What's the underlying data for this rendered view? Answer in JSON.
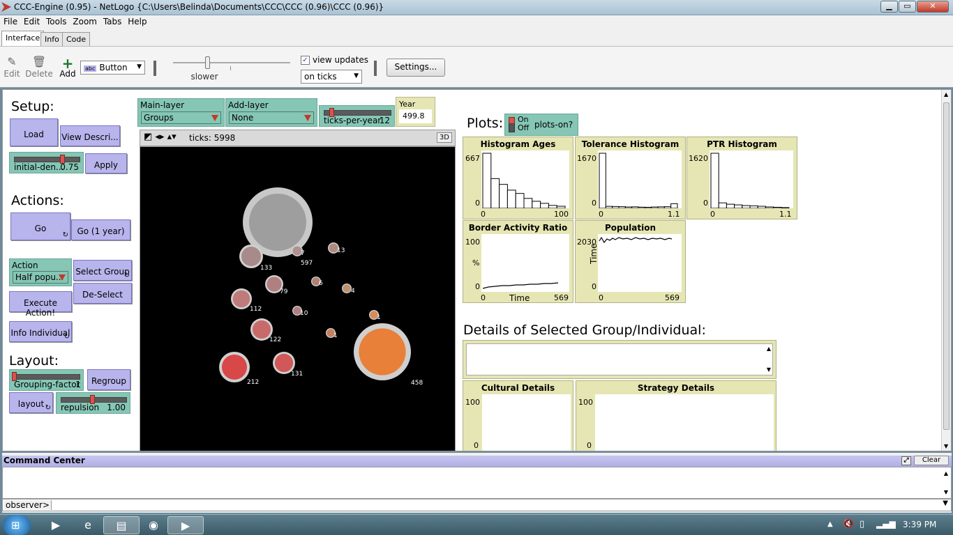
{
  "window": {
    "title": "CCC-Engine (0.95) - NetLogo {C:\\Users\\Belinda\\Documents\\CCC\\CCC (0.96)\\CCC (0.96)}",
    "minimize": "▁",
    "maximize": "▭",
    "close": "✕"
  },
  "menu": [
    "File",
    "Edit",
    "Tools",
    "Zoom",
    "Tabs",
    "Help"
  ],
  "tabs": [
    "Interface",
    "Info",
    "Code"
  ],
  "toolbar": {
    "edit": "Edit",
    "delete": "Delete",
    "add": "Add",
    "widget_type": "Button",
    "widget_type_icon": "abc",
    "speed_label": "slower",
    "view_updates_label": "view updates",
    "update_mode": "on ticks",
    "settings": "Settings..."
  },
  "setup": {
    "header": "Setup:",
    "load": "Load",
    "view_description": "View Descri...",
    "initial_density_label": "initial-den...",
    "initial_density_value": "0.75",
    "initial_density_fraction": 0.75,
    "apply": "Apply"
  },
  "actions": {
    "header": "Actions:",
    "go": "Go",
    "go_1_year": "Go (1 year)",
    "action_chooser_label": "Action",
    "action_chooser_value": "Half popu...",
    "select_group": "Select Group",
    "de_select": "De-Select",
    "execute_action": "Execute Action!",
    "info_individual": "Info Individual"
  },
  "layout": {
    "header": "Layout:",
    "grouping_factor_label": "Grouping-factor",
    "grouping_factor_value": "1",
    "regroup": "Regroup",
    "layout_button": "layout",
    "repulsion_label": "repulsion",
    "repulsion_value": "1.00"
  },
  "top_controls": {
    "main_layer_label": "Main-layer",
    "main_layer_value": "Groups",
    "add_layer_label": "Add-layer",
    "add_layer_value": "None",
    "ticks_per_year_label": "ticks-per-year",
    "ticks_per_year_value": "12",
    "year_label": "Year",
    "year_value": "499.8"
  },
  "view": {
    "ticks": "ticks: 5998",
    "three_d": "3D",
    "groups": [
      {
        "label": "597",
        "color": "#9e9e9e"
      },
      {
        "label": "133",
        "color": "#a88a8a"
      },
      {
        "label": "7",
        "color": "#b09090"
      },
      {
        "label": "13",
        "color": "#b08a80"
      },
      {
        "label": "79",
        "color": "#b08080"
      },
      {
        "label": "6",
        "color": "#b08070"
      },
      {
        "label": "4",
        "color": "#c09070"
      },
      {
        "label": "112",
        "color": "#c07a7a"
      },
      {
        "label": "10",
        "color": "#b08080"
      },
      {
        "label": "1",
        "color": "#d88a5a"
      },
      {
        "label": "122",
        "color": "#c86a6a"
      },
      {
        "label": "1",
        "color": "#c8805a"
      },
      {
        "label": "458",
        "color": "#e8803a"
      },
      {
        "label": "212",
        "color": "#d84848"
      },
      {
        "label": "131",
        "color": "#d05858"
      }
    ]
  },
  "plots": {
    "header": "Plots:",
    "switch_on": "On",
    "switch_off": "Off",
    "switch_label": "plots-on?",
    "histogram_ages": {
      "title": "Histogram Ages",
      "ymax": "667",
      "ymin": "0",
      "xmin": "0",
      "xmax": "100",
      "bars": [
        667,
        360,
        290,
        220,
        180,
        120,
        85,
        60,
        35,
        25
      ]
    },
    "tolerance_histogram": {
      "title": "Tolerance Histogram",
      "ymax": "1670",
      "ymin": "0",
      "xmin": "0",
      "xmax": "1.1",
      "bars": [
        1670,
        60,
        55,
        50,
        40,
        45,
        35,
        30,
        40,
        45,
        50,
        140
      ]
    },
    "ptr_histogram": {
      "title": "PTR Histogram",
      "ymax": "1620",
      "ymin": "0",
      "xmin": "0",
      "xmax": "1.1",
      "bars": [
        1620,
        160,
        120,
        100,
        80,
        70,
        60,
        40,
        30,
        20
      ]
    },
    "border_activity_ratio": {
      "title": "Border Activity Ratio",
      "ymax": "100",
      "ymin": "0",
      "xmin": "0",
      "xmax": "569",
      "xlabel": "Time",
      "ylabel": "%"
    },
    "population": {
      "title": "Population",
      "ymax": "2030",
      "ymin": "0",
      "xmin": "0",
      "xmax": "569",
      "ylabel": "Time"
    }
  },
  "details": {
    "header": "Details of Selected Group/Individual:",
    "cultural": {
      "title": "Cultural Details",
      "ymax": "100",
      "ymin": "0"
    },
    "strategy": {
      "title": "Strategy Details",
      "ymax": "100",
      "ymin": "0"
    }
  },
  "command_center": {
    "title": "Command Center",
    "clear": "Clear",
    "prompt": "observer>"
  },
  "taskbar": {
    "clock": "3:39 PM"
  }
}
